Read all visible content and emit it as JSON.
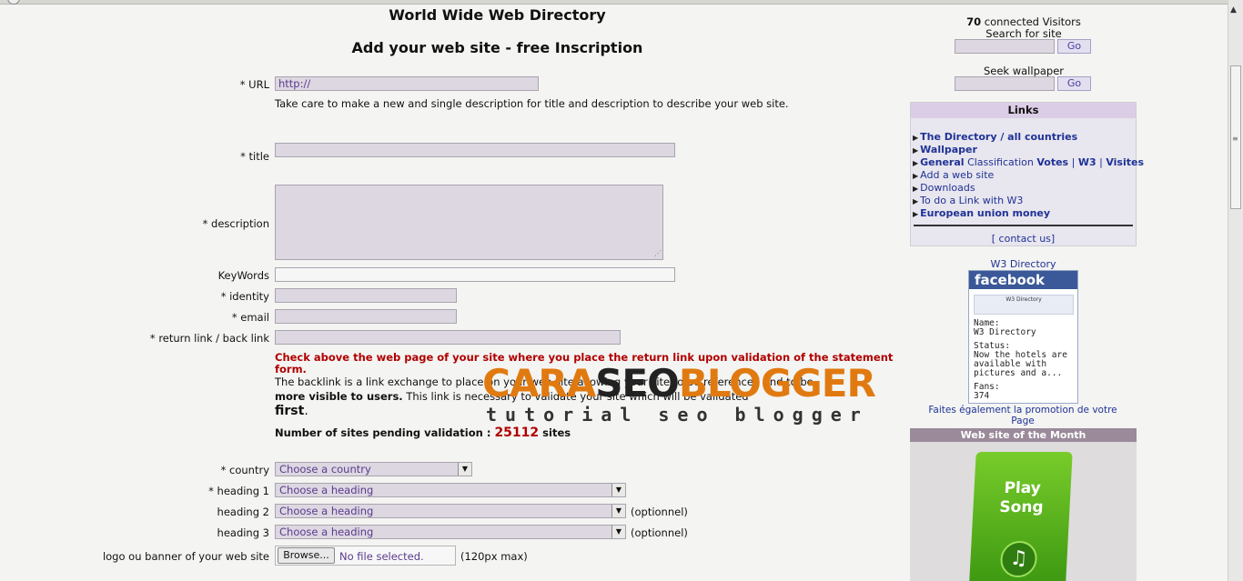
{
  "page": {
    "title": "World Wide Web Directory",
    "subtitle": "Add your web site - free Inscription"
  },
  "form": {
    "url_label": "* URL",
    "url_value": "http://",
    "care_note": "Take care to make a new and single description for title and description to describe your web site.",
    "title_label": "* title",
    "description_label": "* description",
    "keywords_label": "KeyWords",
    "identity_label": "* identity",
    "email_label": "* email",
    "return_link_label": "* return link / back link",
    "warning_line1": "Check above the web page of your site where you place the return link upon validation of the statement",
    "warning_line2": "form.",
    "backlink_line1": "The backlink is a link exchange to place on your web site allowing your site to be referenced and to be",
    "backlink_more_visible": "more visible to users.",
    "backlink_line2_rest": "This link is necessary to validate your site which will be validated",
    "backlink_first": "first",
    "pending_label": "Number of sites pending validation :",
    "pending_count": "25112",
    "pending_unit": "sites",
    "country_label": "* country",
    "country_value": "Choose a country",
    "heading1_label": "* heading 1",
    "heading1_value": "Choose a heading",
    "heading2_label": "heading 2",
    "heading2_value": "Choose a heading",
    "heading2_note": "(optionnel)",
    "heading3_label": "heading 3",
    "heading3_value": "Choose a heading",
    "heading3_note": "(optionnel)",
    "logo_label": "logo ou banner of your web site",
    "browse_label": "Browse...",
    "file_status": "No file selected.",
    "logo_note": "(120px max)"
  },
  "sidebar": {
    "visitors_count": "70",
    "visitors_label": "connected Visitors",
    "search_label": "Search for site",
    "go_label": "Go",
    "wallpaper_label": "Seek wallpaper",
    "links_header": "Links",
    "links": {
      "directory": "The Directory / all countries",
      "wallpaper": "Wallpaper",
      "general": "General",
      "classification": "Classification",
      "votes": "Votes",
      "sep1": "|",
      "w3": "W3",
      "sep2": "|",
      "visites": "Visites",
      "add_site": "Add a web site",
      "downloads": "Downloads",
      "link_w3": "To do a Link with W3",
      "euro": "European union money"
    },
    "contact": "[ contact us]",
    "w3_directory": "W3 Directory",
    "fb": {
      "brand": "facebook",
      "img_text": "W3 Directory",
      "name_label": "Name:",
      "name_value": "W3 Directory",
      "status_label": "Status:",
      "status_l1": "Now the hotels are",
      "status_l2": "available with",
      "status_l3": "pictures and a...",
      "fans_label": "Fans:",
      "fans_value": "374"
    },
    "promo": "Faites également la promotion de votre Page",
    "wom_header": "Web site of the Month",
    "play_song": "Play Song",
    "music_icon": "music-note-icon"
  },
  "watermark": {
    "brand": "CARASEOBLOGGER",
    "brand_part1": "CARA",
    "brand_part2": "SEO",
    "brand_part3": "BLOGGER",
    "tagline": "tutorial seo blogger"
  },
  "colors": {
    "field_bg": "#ddd7e2",
    "warning": "#b00000",
    "link": "#1f3296",
    "fb_blue": "#3b5998",
    "watermark_orange": "#e07a10"
  }
}
